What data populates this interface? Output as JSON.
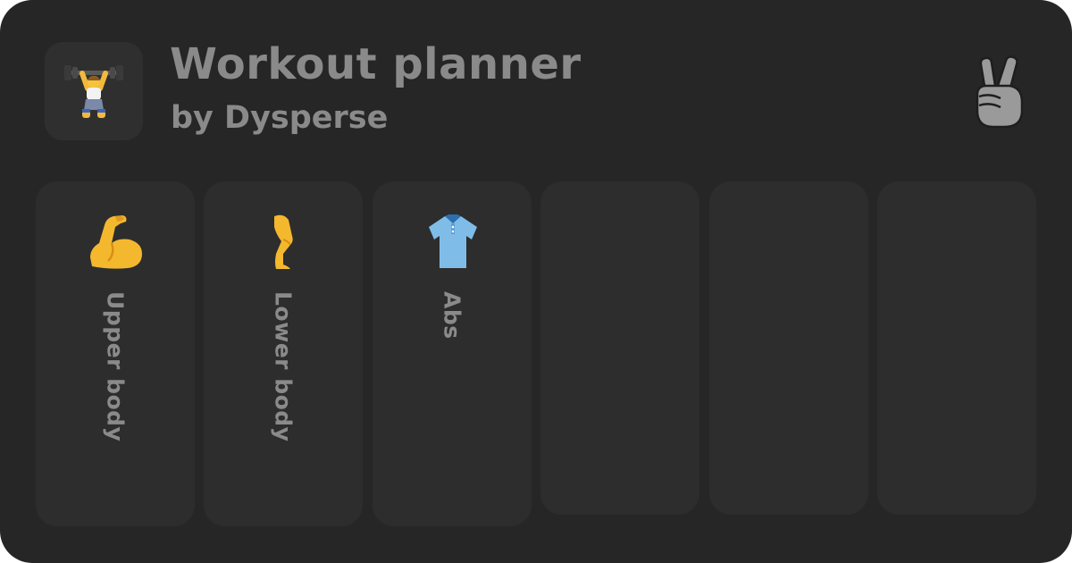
{
  "header": {
    "title": "Workout planner",
    "byline": "by Dysperse",
    "app_icon": "weightlifter-icon",
    "corner_icon": "peace-hand-icon"
  },
  "columns": [
    {
      "label": "Upper body",
      "icon": "flexed-biceps-icon"
    },
    {
      "label": "Lower body",
      "icon": "leg-icon"
    },
    {
      "label": "Abs",
      "icon": "polo-shirt-icon"
    },
    {
      "label": "",
      "icon": ""
    },
    {
      "label": "",
      "icon": ""
    },
    {
      "label": "",
      "icon": ""
    }
  ],
  "colors": {
    "background": "#262626",
    "panel": "#2d2d2d",
    "text": "#8a8a8a"
  }
}
